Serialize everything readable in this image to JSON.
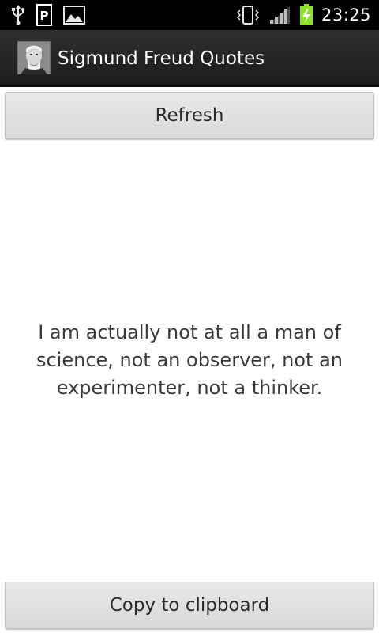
{
  "status_bar": {
    "time": "23:25",
    "icons": [
      "usb-icon",
      "parking-icon",
      "image-notification-icon",
      "vibrate-icon",
      "signal-icon",
      "battery-charging-icon"
    ],
    "battery_color": "#8ee02b"
  },
  "action_bar": {
    "title": "Sigmund Freud Quotes",
    "icon": "app-portrait-icon"
  },
  "refresh_button": {
    "label": "Refresh"
  },
  "quote": {
    "text": "I am actually not at all a man of science, not an observer, not an experimenter, not a thinker."
  },
  "copy_button": {
    "label": "Copy to clipboard"
  }
}
